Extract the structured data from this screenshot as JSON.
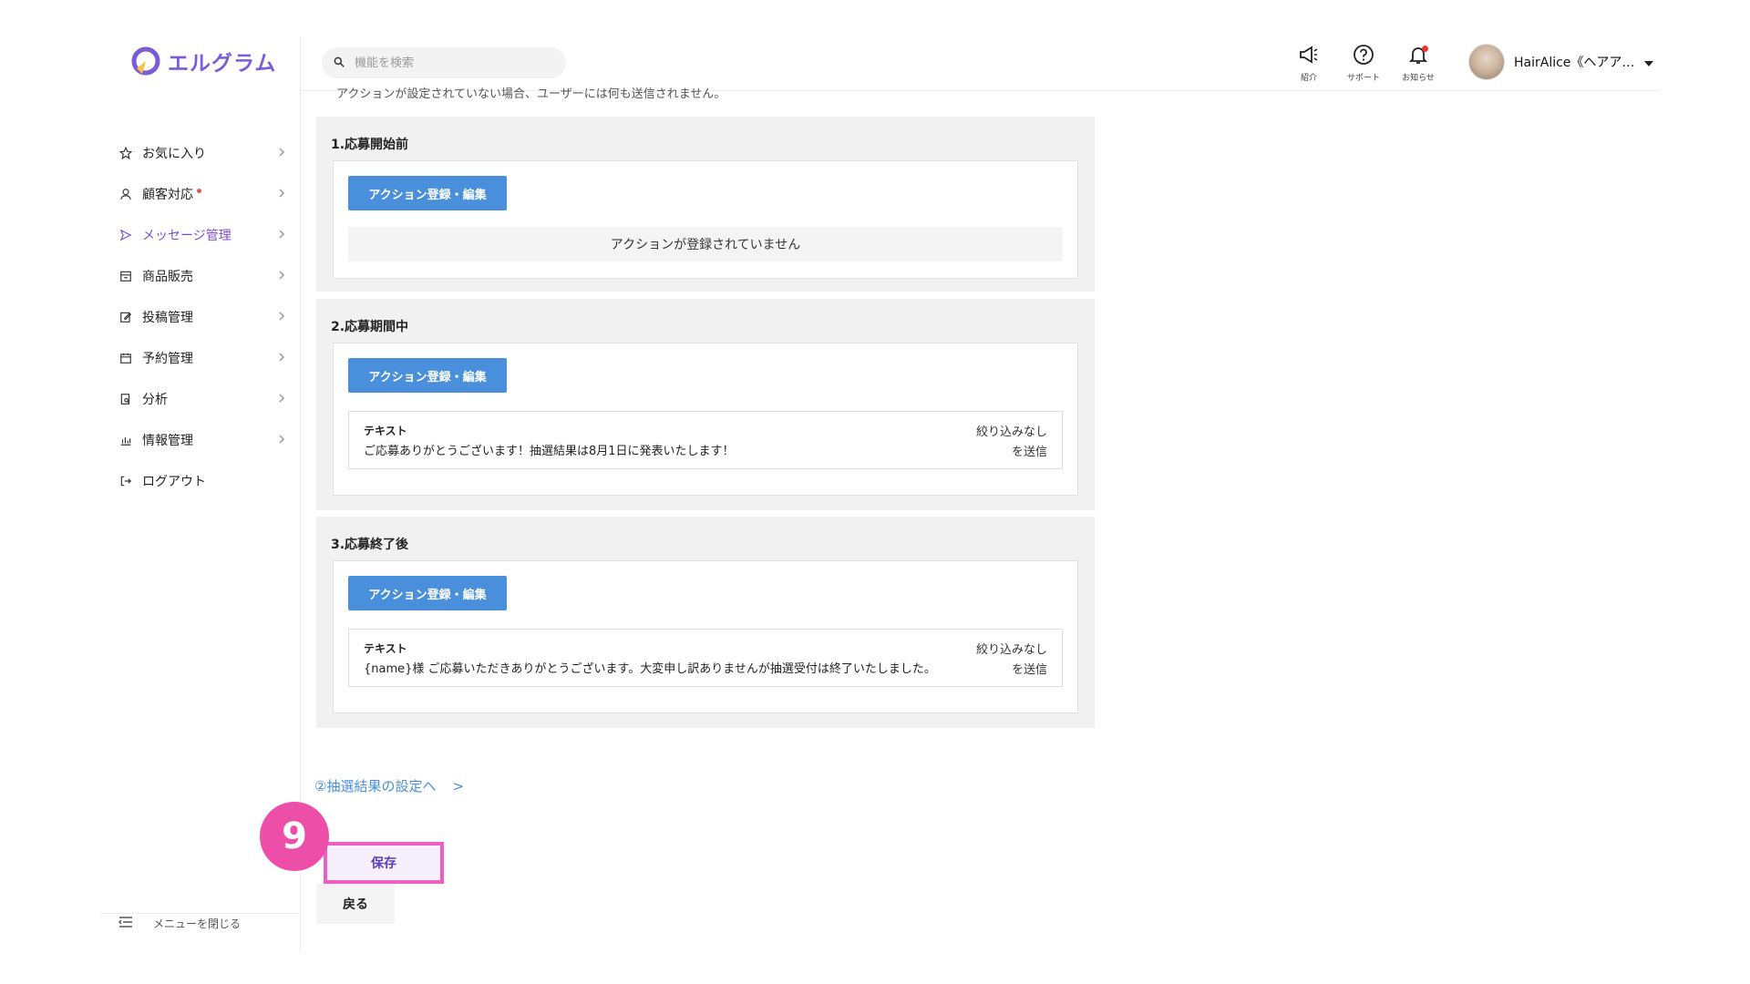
{
  "app": {
    "logo_text": "エルグラム"
  },
  "sidebar": {
    "items": [
      {
        "label": "お気に入り",
        "icon": "star-icon"
      },
      {
        "label": "顧客対応",
        "icon": "user-icon",
        "has_dot": true
      },
      {
        "label": "メッセージ管理",
        "icon": "send-icon",
        "active": true
      },
      {
        "label": "商品販売",
        "icon": "store-icon"
      },
      {
        "label": "投稿管理",
        "icon": "edit-icon"
      },
      {
        "label": "予約管理",
        "icon": "calendar-icon"
      },
      {
        "label": "分析",
        "icon": "report-icon"
      },
      {
        "label": "情報管理",
        "icon": "bar-chart-icon"
      },
      {
        "label": "ログアウト",
        "icon": "logout-icon"
      }
    ],
    "close_menu_label": "メニューを閉じる"
  },
  "header": {
    "search_placeholder": "機能を検索",
    "icons": [
      {
        "label": "紹介",
        "icon": "megaphone-icon"
      },
      {
        "label": "サポート",
        "icon": "help-icon"
      },
      {
        "label": "お知らせ",
        "icon": "bell-icon"
      }
    ],
    "user_name": "HairAlice《ヘアア…"
  },
  "content": {
    "cut_off_text": "アクションが設定されていない場合、ユーザーには何も送信されません。",
    "sections": [
      {
        "title": "1.応募開始前",
        "button_label": "アクション登録・編集",
        "empty_text": "アクションが登録されていません"
      },
      {
        "title": "2.応募期間中",
        "button_label": "アクション登録・編集",
        "message": {
          "type": "テキスト",
          "text": "ご応募ありがとうございます！抽選結果は8月1日に発表いたします！",
          "filter_line1": "絞り込みなし",
          "filter_line2": "を送信"
        }
      },
      {
        "title": "3.応募終了後",
        "button_label": "アクション登録・編集",
        "message": {
          "type": "テキスト",
          "text": "{name}様 ご応募いただきありがとうございます。大変申し訳ありませんが抽選受付は終了いたしました。",
          "filter_line1": "絞り込みなし",
          "filter_line2": "を送信"
        }
      }
    ],
    "next_link_label": "②抽選結果の設定へ",
    "next_link_arrow": ">",
    "save_label": "保存",
    "back_label": "戻る",
    "step_number": "9"
  },
  "colors": {
    "accent": "#7b4fd0",
    "button_blue": "#4a8fdb",
    "highlight_pink": "#ec4ea8"
  }
}
